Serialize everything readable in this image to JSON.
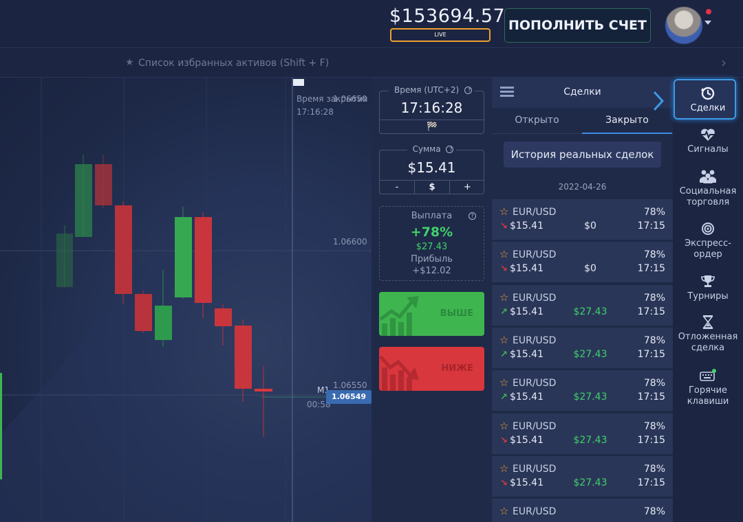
{
  "header": {
    "balance": "$153694.57",
    "account_badge": "LIVE",
    "deposit_button": "ПОПОЛНИТЬ СЧЕТ"
  },
  "favorites_bar": {
    "text": "Список избранных активов (Shift + F)"
  },
  "chart": {
    "expiry_label": "Время закрытия",
    "expiry_time": "17:16:28",
    "price_top": "1.06650",
    "price_mid": "1.06600",
    "price_low": "1.06550",
    "current_price": "1.06549",
    "timeframe": "M1",
    "countdown": "00:58"
  },
  "trade_panel": {
    "time_label": "Время (UTC+2)",
    "time_value": "17:16:28",
    "amount_label": "Сумма",
    "amount_value": "$15.41",
    "minus": "-",
    "currency": "$",
    "plus": "+",
    "payout_label": "Выплата",
    "payout_pct": "+78%",
    "payout_amount": "$27.43",
    "profit_label": "Прибыль",
    "profit_value": "+$12.02",
    "higher_label": "ВЫШЕ",
    "lower_label": "НИЖЕ"
  },
  "deals": {
    "title": "Сделки",
    "tabs": [
      "Открыто",
      "Закрыто"
    ],
    "history_button": "История реальных сделок",
    "date": "2022-04-26",
    "rows": [
      {
        "asset": "EUR/USD",
        "pct": "78%",
        "direction": "down",
        "amount": "$15.41",
        "profit": "$0",
        "time": "17:15"
      },
      {
        "asset": "EUR/USD",
        "pct": "78%",
        "direction": "down",
        "amount": "$15.41",
        "profit": "$0",
        "time": "17:15"
      },
      {
        "asset": "EUR/USD",
        "pct": "78%",
        "direction": "up",
        "amount": "$15.41",
        "profit": "$27.43",
        "time": "17:15"
      },
      {
        "asset": "EUR/USD",
        "pct": "78%",
        "direction": "up",
        "amount": "$15.41",
        "profit": "$27.43",
        "time": "17:15"
      },
      {
        "asset": "EUR/USD",
        "pct": "78%",
        "direction": "up",
        "amount": "$15.41",
        "profit": "$27.43",
        "time": "17:15"
      },
      {
        "asset": "EUR/USD",
        "pct": "78%",
        "direction": "down",
        "amount": "$15.41",
        "profit": "$27.43",
        "time": "17:15"
      },
      {
        "asset": "EUR/USD",
        "pct": "78%",
        "direction": "down",
        "amount": "$15.41",
        "profit": "$27.43",
        "time": "17:15"
      },
      {
        "asset": "EUR/USD",
        "pct": "78%",
        "direction": "",
        "amount": "",
        "profit": "",
        "time": ""
      }
    ]
  },
  "sidebar": {
    "items": [
      {
        "label": "Сделки",
        "icon": "history-icon"
      },
      {
        "label": "Сигналы",
        "icon": "heart-pulse-icon"
      },
      {
        "label": "Социальная торговля",
        "icon": "people-icon"
      },
      {
        "label": "Экспресс-ордер",
        "icon": "target-icon"
      },
      {
        "label": "Турниры",
        "icon": "trophy-icon"
      },
      {
        "label": "Отложенная сделка",
        "icon": "hourglass-icon"
      },
      {
        "label": "Горячие клавиши",
        "icon": "keyboard-icon"
      }
    ]
  },
  "colors": {
    "up": "#3fb54f",
    "down": "#d8373d",
    "profit": "#3fd16a",
    "accent": "#3d9ae8"
  }
}
